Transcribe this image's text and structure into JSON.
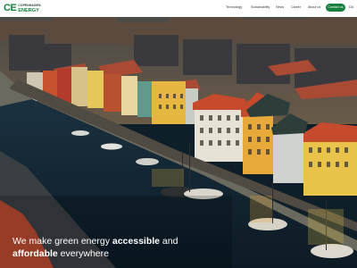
{
  "brand": {
    "mark": "CE",
    "line1": "COPENHAGEN",
    "line2": "ENERGY"
  },
  "nav": {
    "items": [
      "Technology",
      "Sustainability",
      "News",
      "Career",
      "About us"
    ],
    "contact_label": "Contact us",
    "language": "DA"
  },
  "hero": {
    "headline_1": "We make green energy ",
    "headline_bold_1": "accessible",
    "headline_2": " and ",
    "headline_bold_2": "affordable",
    "headline_3": " everywhere"
  },
  "colors": {
    "brand_green": "#15803d",
    "nav_bg": "#ffffff",
    "canal_water": "#10202c"
  },
  "icons": {
    "logo": "copenhagen-energy-logo"
  }
}
